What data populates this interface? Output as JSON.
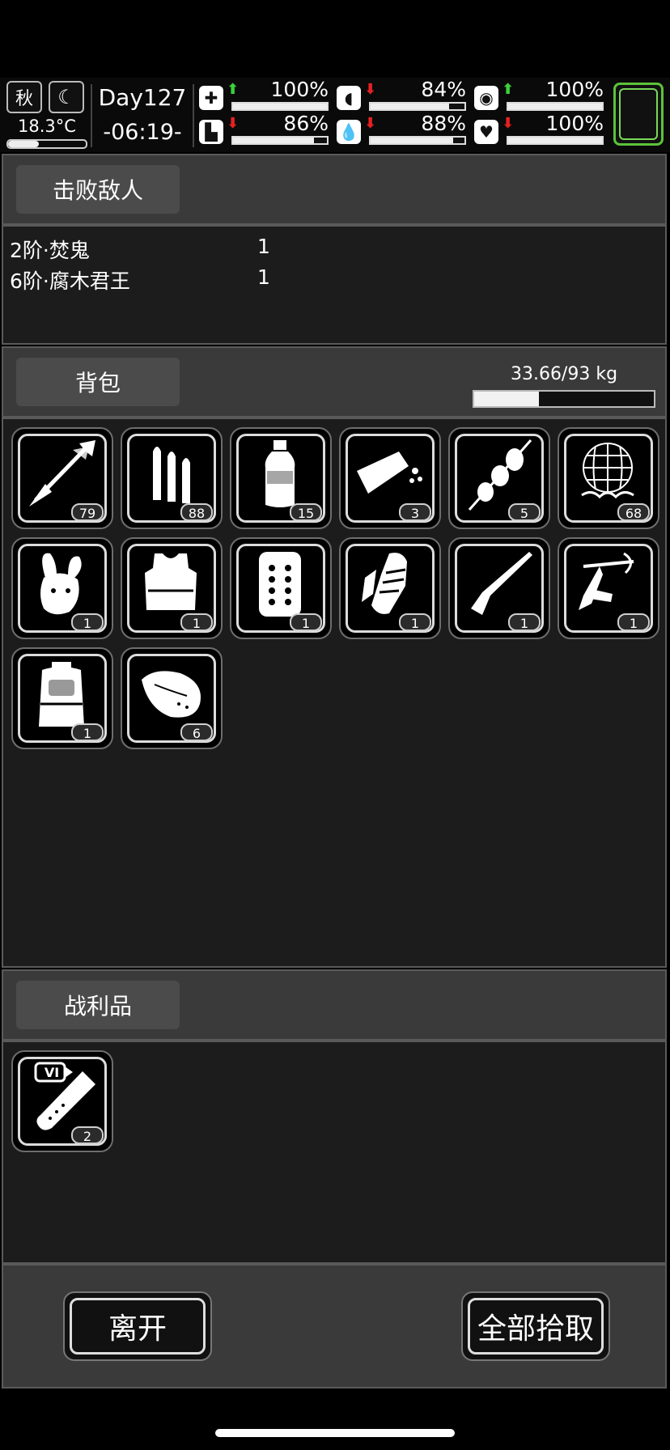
{
  "status": {
    "season": "秋",
    "temperature": "18.3°C",
    "day": "Day127",
    "time": "-06:19-",
    "stats": [
      {
        "name": "health",
        "icon": "medkit-icon",
        "trend": "up",
        "value": "100%",
        "level": 1.0
      },
      {
        "name": "stomach",
        "icon": "stomach-icon",
        "trend": "down",
        "value": "84%",
        "level": 0.84
      },
      {
        "name": "bladder",
        "icon": "bladder-icon",
        "trend": "up",
        "value": "100%",
        "level": 1.0
      },
      {
        "name": "stamina",
        "icon": "boot-icon",
        "trend": "down",
        "value": "86%",
        "level": 0.86
      },
      {
        "name": "water",
        "icon": "water-drop-icon",
        "trend": "down",
        "value": "88%",
        "level": 0.88
      },
      {
        "name": "mood",
        "icon": "heart-icon",
        "trend": "down",
        "value": "100%",
        "level": 1.0
      }
    ]
  },
  "defeated": {
    "title": "击败敌人",
    "enemies": [
      {
        "name": "2阶·焚鬼",
        "count": "1"
      },
      {
        "name": "6阶·腐木君王",
        "count": "1"
      }
    ]
  },
  "backpack": {
    "title": "背包",
    "weight": "33.66/93 kg",
    "weight_fraction": 0.362,
    "items": [
      {
        "icon": "arrow-icon",
        "qty": "79"
      },
      {
        "icon": "bullets-icon",
        "qty": "88"
      },
      {
        "icon": "water-bottle-icon",
        "qty": "15"
      },
      {
        "icon": "bread-icon",
        "qty": "3"
      },
      {
        "icon": "potato-skewer-icon",
        "qty": "5"
      },
      {
        "icon": "net-icon",
        "qty": "68"
      },
      {
        "icon": "rabbit-hat-icon",
        "qty": "1"
      },
      {
        "icon": "body-armor-icon",
        "qty": "1"
      },
      {
        "icon": "plate-icon",
        "qty": "1"
      },
      {
        "icon": "bandaged-gloves-icon",
        "qty": "1"
      },
      {
        "icon": "rifle-icon",
        "qty": "1"
      },
      {
        "icon": "crossbow-icon",
        "qty": "1"
      },
      {
        "icon": "backpack-icon",
        "qty": "1"
      },
      {
        "icon": "meat-icon",
        "qty": "6"
      }
    ]
  },
  "loot": {
    "title": "战利品",
    "items": [
      {
        "icon": "test-tube-vi-icon",
        "badge": "VI",
        "qty": "2"
      }
    ]
  },
  "buttons": {
    "leave": "离开",
    "take_all": "全部拾取"
  }
}
